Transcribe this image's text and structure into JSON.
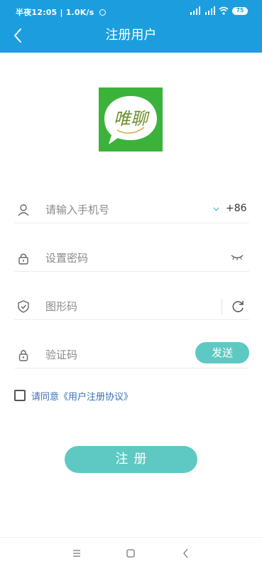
{
  "status_bar": {
    "time": "半夜12:05",
    "speed": "1.0K/s",
    "battery": "75"
  },
  "header": {
    "title": "注册用户",
    "back": "back-arrow"
  },
  "logo": {
    "text": "唯聊"
  },
  "form": {
    "phone": {
      "placeholder": "请输入手机号",
      "country_code": "+86"
    },
    "password": {
      "placeholder": "设置密码"
    },
    "captcha": {
      "placeholder": "图形码"
    },
    "sms": {
      "placeholder": "验证码",
      "send_label": "发送"
    }
  },
  "agreement": {
    "text": "请同意《用户注册协议》",
    "checked": false
  },
  "register_button": {
    "label": "注册"
  },
  "colors": {
    "header": "#1c9ede",
    "accent": "#5ec9c2",
    "link": "#3d6fb6",
    "logo_bg": "#3bb33a"
  },
  "nav": {
    "icons": [
      "menu-icon",
      "home-square-icon",
      "back-triangle-icon"
    ]
  }
}
